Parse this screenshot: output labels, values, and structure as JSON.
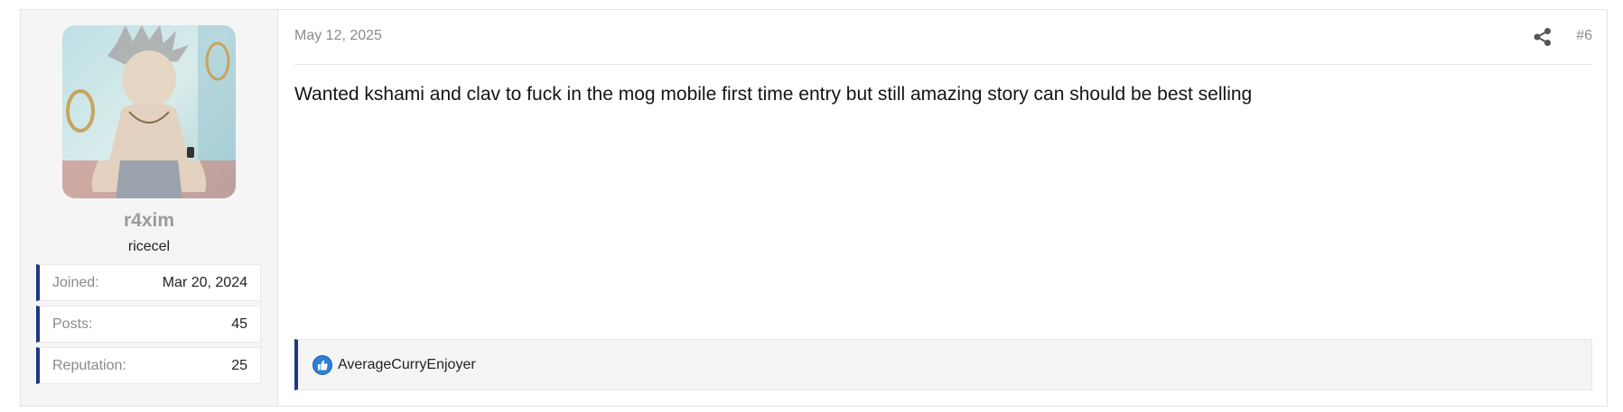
{
  "user": {
    "avatar_icon": "user-avatar",
    "username": "r4xim",
    "title": "ricecel",
    "extras": [
      {
        "label": "Joined:",
        "value": "Mar 20, 2024"
      },
      {
        "label": "Posts:",
        "value": "45"
      },
      {
        "label": "Reputation:",
        "value": "25"
      }
    ]
  },
  "post": {
    "date": "May 12, 2025",
    "number": "#6",
    "share_icon": "share-icon",
    "message": "Wanted kshami and clav to fuck in the mog mobile first time entry but still amazing story can should be best selling",
    "reactions": {
      "icon": "like-icon",
      "users": "AverageCurryEnjoyer"
    }
  },
  "colors": {
    "accent": "#1f3783",
    "like": "#2f7fd3",
    "username": "#9b9b9b"
  }
}
